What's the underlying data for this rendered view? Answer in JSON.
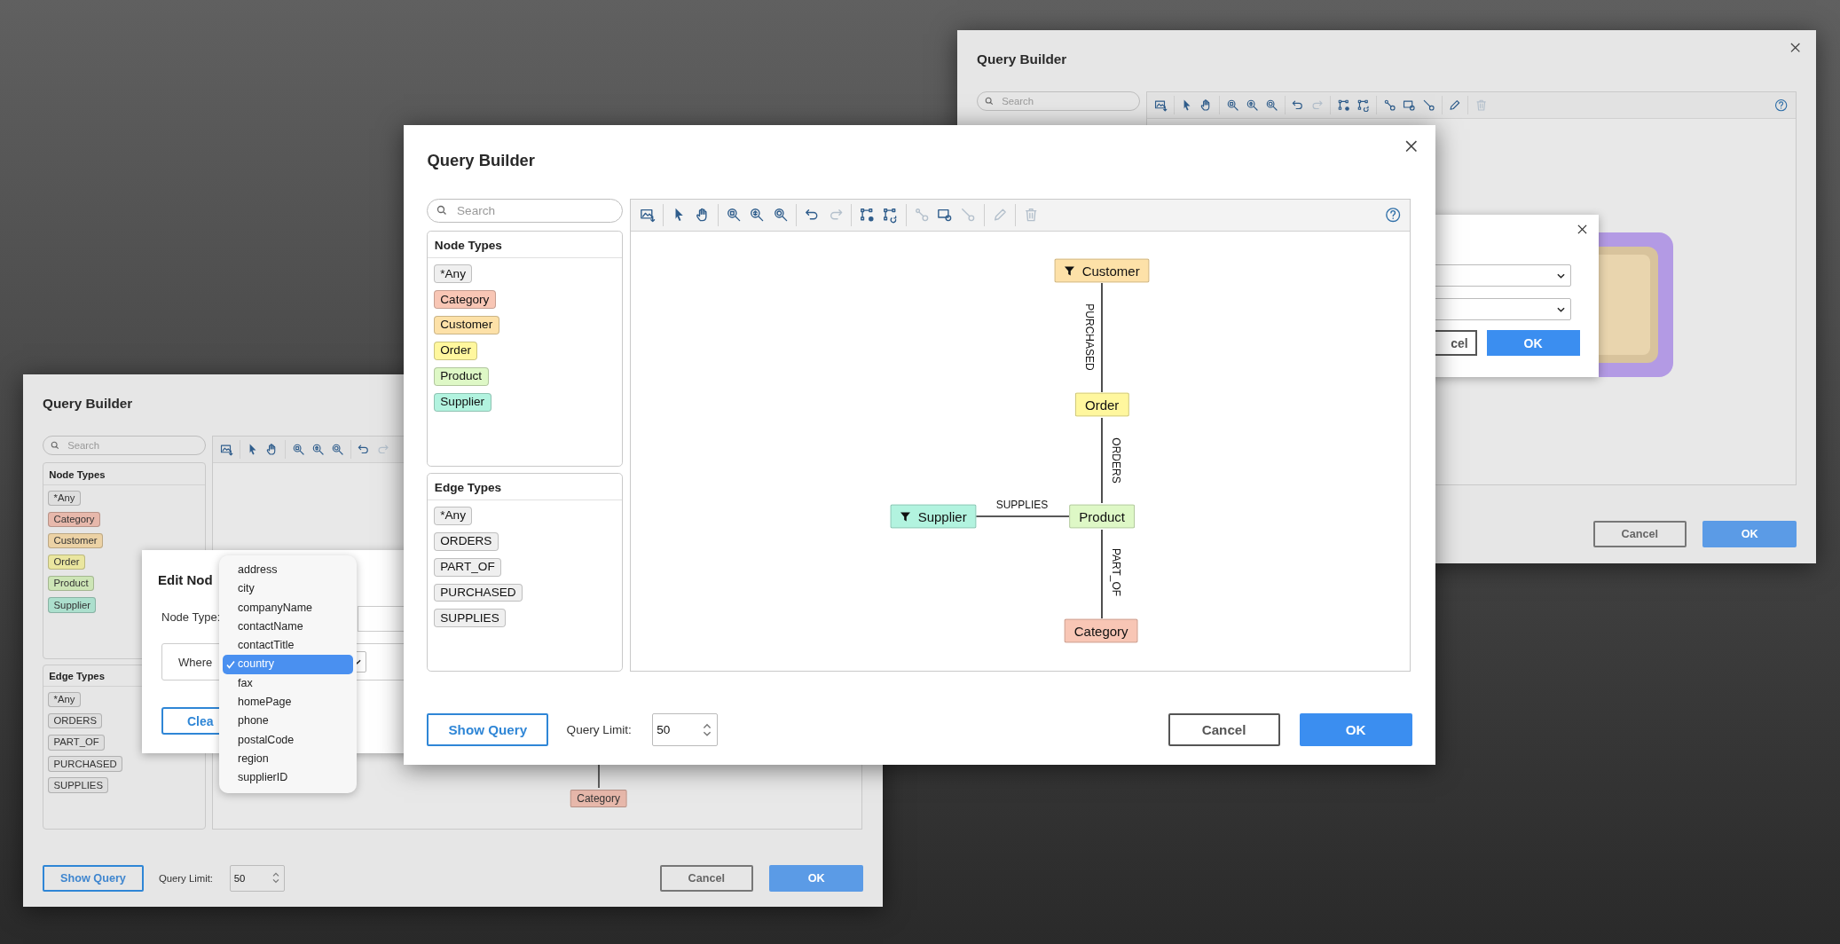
{
  "back_window": {
    "title": "Query Builder",
    "search": {
      "placeholder": "Search"
    },
    "toolbar": [
      {
        "kind": "image",
        "disabled": false
      },
      {
        "kind": "cursor",
        "disabled": false
      },
      {
        "kind": "hand",
        "disabled": false
      },
      {
        "kind": "zoom-fit",
        "disabled": false
      },
      {
        "kind": "zoom-in",
        "disabled": false
      },
      {
        "kind": "zoom-reset",
        "disabled": false
      },
      {
        "kind": "undo",
        "disabled": false
      },
      {
        "kind": "redo",
        "disabled": true
      },
      {
        "kind": "node-add",
        "disabled": false
      },
      {
        "kind": "node-refresh",
        "disabled": false
      },
      {
        "kind": "link",
        "disabled": false
      },
      {
        "kind": "box-add",
        "disabled": false
      },
      {
        "kind": "connector",
        "disabled": false
      },
      {
        "kind": "pencil",
        "disabled": false
      },
      {
        "kind": "trash",
        "disabled": true
      }
    ],
    "dialog": {
      "cancel_button": "cel",
      "ok_button": "OK"
    },
    "footer": {
      "cancel": "Cancel",
      "ok": "OK"
    }
  },
  "left_window": {
    "title": "Query Builder",
    "search": {
      "placeholder": "Search"
    },
    "toolbar": [
      {
        "kind": "image",
        "disabled": false
      },
      {
        "kind": "cursor",
        "disabled": false
      },
      {
        "kind": "hand",
        "disabled": false
      },
      {
        "kind": "zoom-fit",
        "disabled": false
      },
      {
        "kind": "zoom-in",
        "disabled": false
      },
      {
        "kind": "zoom-reset",
        "disabled": false
      },
      {
        "kind": "undo",
        "disabled": false
      },
      {
        "kind": "redo",
        "disabled": true
      }
    ],
    "node_types": {
      "title": "Node Types",
      "items": [
        {
          "label": "*Any",
          "color": "#dedede"
        },
        {
          "label": "Category",
          "color": "#e7b8ab"
        },
        {
          "label": "Customer",
          "color": "#ecd2a5"
        },
        {
          "label": "Order",
          "color": "#eae69f"
        },
        {
          "label": "Product",
          "color": "#cde5b6"
        },
        {
          "label": "Supplier",
          "color": "#acdfcd"
        }
      ]
    },
    "edge_types": {
      "title": "Edge Types",
      "items": [
        {
          "label": "*Any"
        },
        {
          "label": "ORDERS"
        },
        {
          "label": "PART_OF"
        },
        {
          "label": "PURCHASED"
        },
        {
          "label": "SUPPLIES"
        }
      ]
    },
    "graph": {
      "nodes": [
        {
          "label": "Category",
          "color": "#e7b8ab"
        }
      ]
    },
    "edit_dialog": {
      "title": "Edit Nod",
      "node_type_label": "Node Type:",
      "where_label": "Where",
      "clear_button": "Clea"
    },
    "field_menu": {
      "options": [
        {
          "label": "address",
          "selected": false
        },
        {
          "label": "city",
          "selected": false
        },
        {
          "label": "companyName",
          "selected": false
        },
        {
          "label": "contactName",
          "selected": false
        },
        {
          "label": "contactTitle",
          "selected": false
        },
        {
          "label": "country",
          "selected": true
        },
        {
          "label": "fax",
          "selected": false
        },
        {
          "label": "homePage",
          "selected": false
        },
        {
          "label": "phone",
          "selected": false
        },
        {
          "label": "postalCode",
          "selected": false
        },
        {
          "label": "region",
          "selected": false
        },
        {
          "label": "supplierID",
          "selected": false
        }
      ]
    },
    "footer": {
      "show_query": "Show Query",
      "query_limit_label": "Query Limit:",
      "query_limit": "50",
      "cancel": "Cancel",
      "ok": "OK"
    }
  },
  "front_window": {
    "title": "Query Builder",
    "search": {
      "placeholder": "Search"
    },
    "toolbar": [
      {
        "kind": "image",
        "disabled": false
      },
      {
        "kind": "cursor",
        "disabled": false
      },
      {
        "kind": "hand",
        "disabled": false
      },
      {
        "kind": "zoom-fit",
        "disabled": false
      },
      {
        "kind": "zoom-in",
        "disabled": false
      },
      {
        "kind": "zoom-reset",
        "disabled": false
      },
      {
        "kind": "undo",
        "disabled": false
      },
      {
        "kind": "redo",
        "disabled": true
      },
      {
        "kind": "node-add",
        "disabled": false
      },
      {
        "kind": "node-refresh",
        "disabled": false
      },
      {
        "kind": "link",
        "disabled": true
      },
      {
        "kind": "box-add",
        "disabled": false
      },
      {
        "kind": "connector",
        "disabled": true
      },
      {
        "kind": "pencil",
        "disabled": true
      },
      {
        "kind": "trash",
        "disabled": true
      }
    ],
    "node_types": {
      "title": "Node Types",
      "items": [
        {
          "label": "*Any",
          "color": "#efefef"
        },
        {
          "label": "Category",
          "color": "#f8c6b5"
        },
        {
          "label": "Customer",
          "color": "#fde1a8"
        },
        {
          "label": "Order",
          "color": "#fff79e"
        },
        {
          "label": "Product",
          "color": "#def8c6"
        },
        {
          "label": "Supplier",
          "color": "#b2f3df"
        }
      ]
    },
    "edge_types": {
      "title": "Edge Types",
      "items": [
        {
          "label": "*Any"
        },
        {
          "label": "ORDERS"
        },
        {
          "label": "PART_OF"
        },
        {
          "label": "PURCHASED"
        },
        {
          "label": "SUPPLIES"
        }
      ]
    },
    "graph": {
      "nodes": [
        {
          "label": "Customer",
          "color": "#fde1a8",
          "filter": true
        },
        {
          "label": "Order",
          "color": "#fff79e",
          "filter": false
        },
        {
          "label": "Supplier",
          "color": "#b2f3df",
          "filter": true
        },
        {
          "label": "Product",
          "color": "#def8c6",
          "filter": false
        },
        {
          "label": "Category",
          "color": "#f8c6b5",
          "filter": false
        }
      ],
      "edges": [
        {
          "label": "PURCHASED"
        },
        {
          "label": "ORDERS"
        },
        {
          "label": "PART_OF"
        },
        {
          "label": "SUPPLIES"
        }
      ]
    },
    "footer": {
      "show_query": "Show Query",
      "query_limit_label": "Query Limit:",
      "query_limit": "50",
      "cancel": "Cancel",
      "ok": "OK"
    }
  }
}
